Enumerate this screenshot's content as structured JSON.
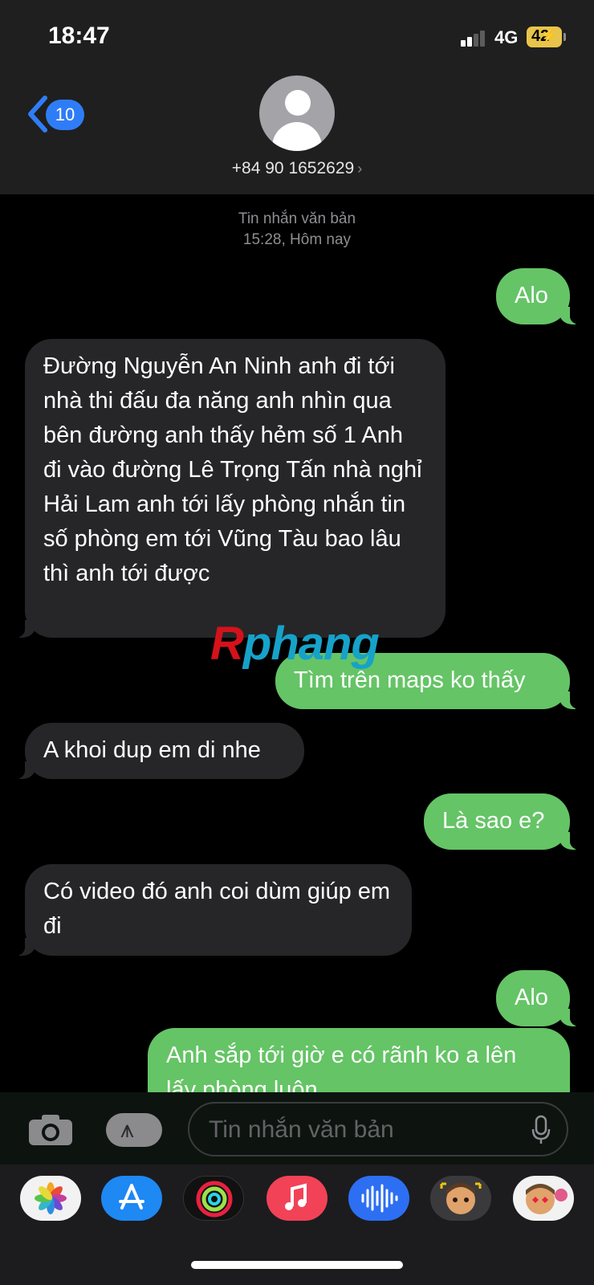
{
  "status_bar": {
    "time": "18:47",
    "network": "4G",
    "battery": "42"
  },
  "header": {
    "back_count": "10",
    "contact": "+84 90 1652629"
  },
  "thread": {
    "meta_type": "Tin nhắn văn bản",
    "meta_time": "15:28, Hôm nay"
  },
  "messages": [
    {
      "dir": "out",
      "text": "Alo"
    },
    {
      "dir": "in",
      "text": "Đường Nguyễn An Ninh anh đi tới nhà thi đấu đa năng anh nhìn qua bên đường anh thấy hẻm số 1 Anh đi vào đường Lê Trọng Tấn nhà nghỉ Hải Lam anh tới lấy phòng nhắn tin số phòng em tới Vũng Tàu bao lâu thì anh tới được"
    },
    {
      "dir": "out",
      "text": "Tìm trên maps ko thấy"
    },
    {
      "dir": "in",
      "text": "A khoi dup em di nhe"
    },
    {
      "dir": "out",
      "text": "Là sao e?"
    },
    {
      "dir": "in",
      "text": "Có video đó anh coi dùm giúp em đi"
    },
    {
      "dir": "out",
      "text": "Alo"
    },
    {
      "dir": "out",
      "text": "Anh sắp tới giờ e có rãnh ko a lên lấy phòng luôn"
    }
  ],
  "watermark": {
    "part1": "R",
    "part2": "phang"
  },
  "input": {
    "placeholder": "Tin nhắn văn bản"
  },
  "icons": [
    "camera-icon",
    "app-store-icon",
    "microphone-icon",
    "photos-app-icon",
    "app-store-app-icon",
    "fitness-app-icon",
    "music-app-icon",
    "voice-memos-app-icon",
    "memoji-app-icon",
    "memoji-stickers-app-icon"
  ],
  "colors": {
    "outgoing": "#65c466",
    "incoming": "#262628",
    "badge": "#2f7df6"
  }
}
